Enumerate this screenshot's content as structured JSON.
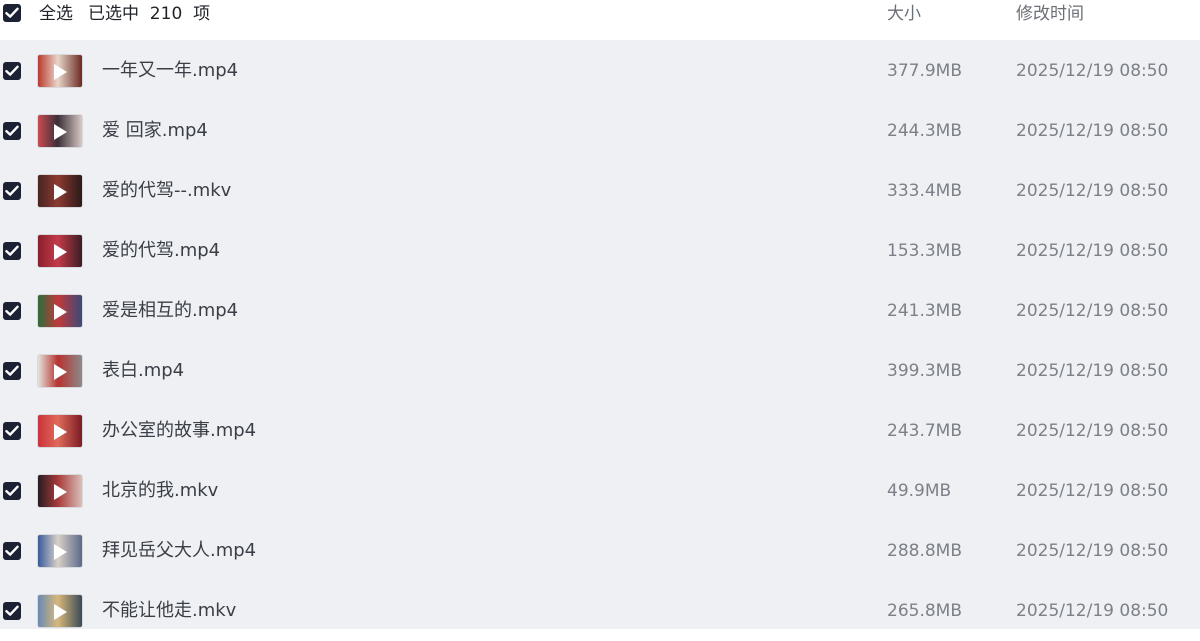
{
  "header": {
    "select_all_label": "全选",
    "selected_text": "已选中  210  项",
    "size_col": "大小",
    "time_col": "修改时间"
  },
  "files": [
    {
      "name": "一年又一年.mp4",
      "size": "377.9MB",
      "time": "2025/12/19 08:50",
      "thumb_colors": [
        "#b83a2e",
        "#e8d6c8",
        "#6b2a24"
      ]
    },
    {
      "name": "爱 回家.mp4",
      "size": "244.3MB",
      "time": "2025/12/19 08:50",
      "thumb_colors": [
        "#c94c52",
        "#3b3038",
        "#d9c9c5"
      ]
    },
    {
      "name": "爱的代驾--.mkv",
      "size": "333.4MB",
      "time": "2025/12/19 08:50",
      "thumb_colors": [
        "#4a2422",
        "#8c3a30",
        "#2a1a1a"
      ]
    },
    {
      "name": "爱的代驾.mp4",
      "size": "153.3MB",
      "time": "2025/12/19 08:50",
      "thumb_colors": [
        "#8a1f2c",
        "#c43b4a",
        "#3a1e24"
      ]
    },
    {
      "name": "爱是相互的.mp4",
      "size": "241.3MB",
      "time": "2025/12/19 08:50",
      "thumb_colors": [
        "#2f6b3a",
        "#c23a3a",
        "#3a4a7a"
      ]
    },
    {
      "name": "表白.mp4",
      "size": "399.3MB",
      "time": "2025/12/19 08:50",
      "thumb_colors": [
        "#e6e2dc",
        "#b7332f",
        "#8a8a8a"
      ]
    },
    {
      "name": "办公室的故事.mp4",
      "size": "243.7MB",
      "time": "2025/12/19 08:50",
      "thumb_colors": [
        "#c9333a",
        "#e06a5a",
        "#7a1c24"
      ]
    },
    {
      "name": "北京的我.mkv",
      "size": "49.9MB",
      "time": "2025/12/19 08:50",
      "thumb_colors": [
        "#2a1c22",
        "#a83a3a",
        "#d8c0b8"
      ]
    },
    {
      "name": "拜见岳父大人.mp4",
      "size": "288.8MB",
      "time": "2025/12/19 08:50",
      "thumb_colors": [
        "#3a5a9a",
        "#d9d0c8",
        "#5a6a8a"
      ]
    },
    {
      "name": "不能让他走.mkv",
      "size": "265.8MB",
      "time": "2025/12/19 08:50",
      "thumb_colors": [
        "#6a8ab0",
        "#d8b87a",
        "#3a4a5a"
      ]
    }
  ]
}
